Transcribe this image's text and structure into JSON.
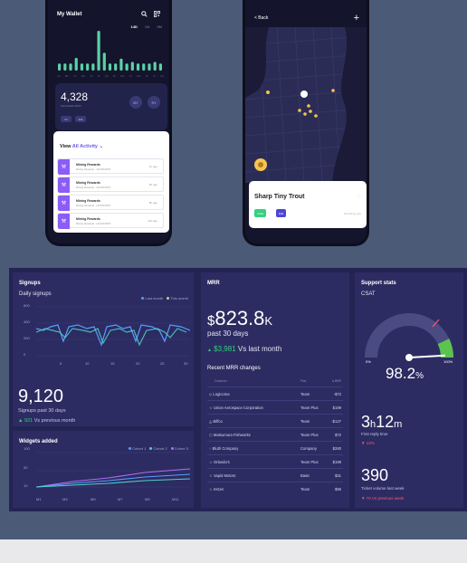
{
  "wallet": {
    "title": "My Wallet",
    "tabs": [
      "14D",
      "1M",
      "6M"
    ],
    "bar_values": [
      0.18,
      0.18,
      0.18,
      0.32,
      0.18,
      0.18,
      0.18,
      1.0,
      0.45,
      0.18,
      0.18,
      0.3,
      0.18,
      0.22,
      0.18,
      0.18,
      0.18,
      0.22,
      0.18
    ],
    "bar_days": [
      "Su",
      "Mo",
      "Tu",
      "We",
      "Th",
      "Fr",
      "Sa",
      "Su",
      "Mo",
      "Tu",
      "We",
      "Th",
      "Fr",
      "Sa"
    ],
    "balance": "4,328",
    "balance_sub": "CHANGES MINT",
    "circle_btns": [
      "BY",
      "SY"
    ],
    "chips": [
      "≡≡",
      "⊕⊕"
    ],
    "activity_heading": "View",
    "activity_link": "All Activity",
    "activity_rows": [
      {
        "title": "Mining Rewards",
        "date": "Mining Rewards · HOUR MINT",
        "time": "1h ago"
      },
      {
        "title": "Mining Rewards",
        "date": "Mining Rewards · HOUR MINT",
        "time": "5h ago"
      },
      {
        "title": "Mining Rewards",
        "date": "Mining Rewards · HOUR MINT",
        "time": "8h ago"
      },
      {
        "title": "Mining Rewards",
        "date": "Mining Rewards · HOUR MINT",
        "time": "12h ago"
      }
    ]
  },
  "map_screen": {
    "back_label": "< Back",
    "plus_label": "+",
    "card_title": "Sharp Tiny Trout",
    "btn_primary": "Invite",
    "btn_secondary": "Edit",
    "note": "Owned by you"
  },
  "signups": {
    "title": "Signups",
    "chart_title": "Daily signups",
    "legend": [
      "Last month",
      "This month"
    ],
    "y_ticks": [
      "600",
      "400",
      "200",
      "0"
    ],
    "x_ticks": [
      "5",
      "10",
      "15",
      "20",
      "25",
      "30"
    ],
    "total": "9,120",
    "total_label": "Signups past 30 days",
    "delta": "921",
    "delta_label": "Vs previous month"
  },
  "widgets": {
    "title": "Widgets added",
    "legend": [
      "Cohort 1",
      "Cohort 2",
      "Cohort 3"
    ],
    "y_ticks": [
      "100",
      "50",
      "10"
    ],
    "x_ticks": [
      "M1",
      "M3",
      "M5",
      "M7",
      "M9",
      "M11"
    ]
  },
  "mrr": {
    "title": "MRR",
    "value": "823.8",
    "unit": "K",
    "currency": "$",
    "period": "past 30 days",
    "delta": "$3,981",
    "delta_label": "Vs last month",
    "changes_title": "Recent MRR changes",
    "headers": [
      "Customer",
      "Plan",
      "Δ MRR"
    ],
    "rows": [
      {
        "name": "Logicoma",
        "plan": "Team",
        "mrr": "-$72"
      },
      {
        "name": "Union Aerospace Corporation",
        "plan": "Team Plus",
        "mrr": "$199"
      },
      {
        "name": "Biffco",
        "plan": "Team",
        "mrr": "-$127"
      },
      {
        "name": "Matsumura Fishworks",
        "plan": "Team Plus",
        "mrr": "$72"
      },
      {
        "name": "Bluth Company",
        "plan": "Company",
        "mrr": "$280"
      },
      {
        "name": "Orlando's",
        "plan": "Team Plus",
        "mrr": "$199"
      },
      {
        "name": "Vapid Motors",
        "plan": "Basic",
        "mrr": "$31"
      },
      {
        "name": "InGen",
        "plan": "Team",
        "mrr": "$96"
      }
    ]
  },
  "support": {
    "title": "Support stats",
    "csat_label": "CSAT",
    "gauge_min": "0%",
    "gauge_max": "100%",
    "gauge_value": 98.2,
    "csat_value": "98.2",
    "csat_unit": "%",
    "reply_h": "3",
    "reply_m": "12",
    "reply_label": "First reply time",
    "reply_delta": "12%",
    "tickets": "390",
    "tickets_label": "Ticket volume last week",
    "tickets_delta": "70",
    "tickets_delta_label": "Vs previous week"
  },
  "colors": {
    "accent_purple": "#8b5cf6",
    "green": "#35d07f",
    "red": "#ff5b6b",
    "series_blue": "#5b9cff",
    "series_teal": "#4fd1c5"
  }
}
